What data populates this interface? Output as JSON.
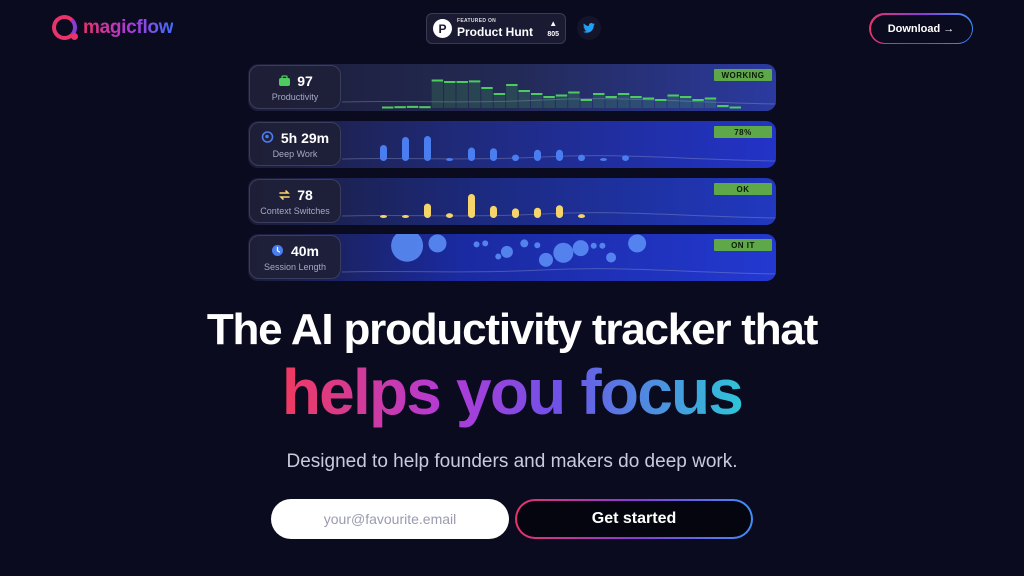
{
  "header": {
    "logo_text": "magicflow",
    "product_hunt": {
      "featured": "FEATURED ON",
      "name": "Product Hunt",
      "votes": "805"
    },
    "download_label": "Download →"
  },
  "metrics": [
    {
      "value": "97",
      "label": "Productivity",
      "status": "WORKING",
      "icon": "briefcase-icon",
      "color": "#4ecb5e",
      "bars": [
        0.05,
        0.06,
        0.07,
        0.06,
        0.95,
        0.9,
        0.9,
        0.92,
        0.7,
        0.5,
        0.8,
        0.6,
        0.5,
        0.4,
        0.45,
        0.55,
        0.3,
        0.5,
        0.4,
        0.5,
        0.4,
        0.35,
        0.3,
        0.45,
        0.4,
        0.3,
        0.35,
        0.1,
        0.05
      ]
    },
    {
      "value": "5h 29m",
      "label": "Deep Work",
      "status": "78%",
      "icon": "head-icon",
      "color": "#4a7df0",
      "bars": [
        0.5,
        0.75,
        0.78,
        0.08,
        0.42,
        0.4,
        0.2,
        0.35,
        0.35,
        0.2,
        0.05,
        0.18
      ]
    },
    {
      "value": "78",
      "label": "Context Switches",
      "status": "OK",
      "icon": "switch-arrows-icon",
      "color": "#f5d56b",
      "bars": [
        0.05,
        0.06,
        0.45,
        0.15,
        0.75,
        0.38,
        0.3,
        0.32,
        0.4,
        0.12
      ]
    },
    {
      "value": "40m",
      "label": "Session Length",
      "status": "ON IT",
      "icon": "clock-icon",
      "color": "#4a7df0",
      "bubbles": [
        [
          0.15,
          0.25,
          16
        ],
        [
          0.22,
          0.2,
          9
        ],
        [
          0.31,
          0.22,
          3
        ],
        [
          0.33,
          0.2,
          3
        ],
        [
          0.36,
          0.48,
          3
        ],
        [
          0.38,
          0.38,
          6
        ],
        [
          0.42,
          0.2,
          4
        ],
        [
          0.45,
          0.24,
          3
        ],
        [
          0.47,
          0.55,
          7
        ],
        [
          0.51,
          0.4,
          10
        ],
        [
          0.55,
          0.3,
          8
        ],
        [
          0.58,
          0.25,
          3
        ],
        [
          0.6,
          0.25,
          3
        ],
        [
          0.62,
          0.5,
          5
        ],
        [
          0.68,
          0.2,
          9
        ]
      ]
    }
  ],
  "hero": {
    "headline": "The AI productivity tracker that",
    "focus_words": [
      "helps",
      "you",
      "focus"
    ],
    "tagline": "Designed to help founders and makers do deep work.",
    "email_placeholder": "your@favourite.email",
    "cta_label": "Get started"
  }
}
